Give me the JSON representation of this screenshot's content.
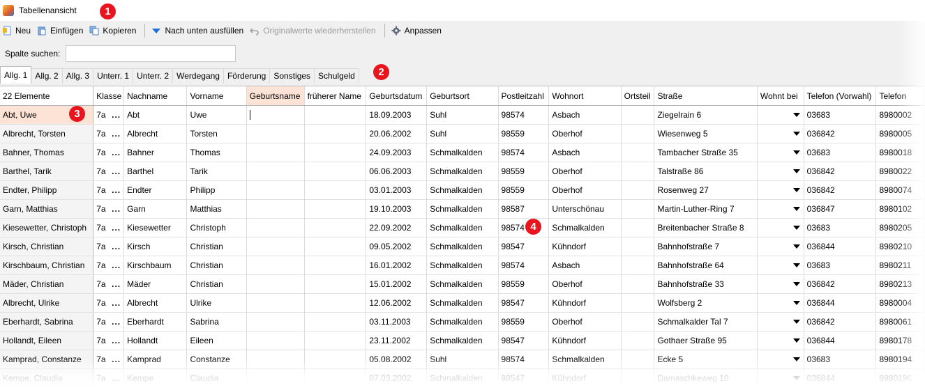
{
  "window": {
    "title": "Tabellenansicht"
  },
  "toolbar": {
    "new_label": "Neu",
    "insert_label": "Einfügen",
    "copy_label": "Kopieren",
    "fill_down_label": "Nach unten ausfüllen",
    "restore_label": "Originalwerte wiederherstellen",
    "customize_label": "Anpassen"
  },
  "search": {
    "label": "Spalte suchen:",
    "value": "",
    "placeholder": ""
  },
  "tabs": [
    {
      "label": "Allg. 1"
    },
    {
      "label": "Allg. 2"
    },
    {
      "label": "Allg. 3"
    },
    {
      "label": "Unterr. 1"
    },
    {
      "label": "Unterr. 2"
    },
    {
      "label": "Werdegang"
    },
    {
      "label": "Förderung"
    },
    {
      "label": "Sonstiges"
    },
    {
      "label": "Schulgeld"
    }
  ],
  "grid": {
    "count_label": "22 Elemente",
    "columns": [
      "Klasse",
      "Nachname",
      "Vorname",
      "Geburtsname",
      "früherer Name",
      "Geburtsdatum",
      "Geburtsort",
      "Postleitzahl",
      "Wohnort",
      "Ortsteil",
      "Straße",
      "Wohnt bei",
      "Telefon (Vorwahl)",
      "Telefon"
    ],
    "rows": [
      {
        "head": "Abt, Uwe",
        "klasse": "7a",
        "nachname": "Abt",
        "vorname": "Uwe",
        "geburtsname": "",
        "frueher": "",
        "geburtsdatum": "18.09.2003",
        "geburtsort": "Suhl",
        "plz": "98574",
        "wohnort": "Asbach",
        "ortsteil": "",
        "strasse": "Ziegelrain 6",
        "vorwahl": "03683",
        "telefon": "8980002"
      },
      {
        "head": "Albrecht, Torsten",
        "klasse": "7a",
        "nachname": "Albrecht",
        "vorname": "Torsten",
        "geburtsname": "",
        "frueher": "",
        "geburtsdatum": "20.06.2002",
        "geburtsort": "Suhl",
        "plz": "98559",
        "wohnort": "Oberhof",
        "ortsteil": "",
        "strasse": "Wiesenweg 5",
        "vorwahl": "036842",
        "telefon": "8980005"
      },
      {
        "head": "Bahner, Thomas",
        "klasse": "7a",
        "nachname": "Bahner",
        "vorname": "Thomas",
        "geburtsname": "",
        "frueher": "",
        "geburtsdatum": "24.09.2003",
        "geburtsort": "Schmalkalden",
        "plz": "98574",
        "wohnort": "Asbach",
        "ortsteil": "",
        "strasse": "Tambacher Straße 35",
        "vorwahl": "03683",
        "telefon": "8980018"
      },
      {
        "head": "Barthel, Tarik",
        "klasse": "7a",
        "nachname": "Barthel",
        "vorname": "Tarik",
        "geburtsname": "",
        "frueher": "",
        "geburtsdatum": "06.06.2003",
        "geburtsort": "Schmalkalden",
        "plz": "98559",
        "wohnort": "Oberhof",
        "ortsteil": "",
        "strasse": "Talstraße 86",
        "vorwahl": "036842",
        "telefon": "8980022"
      },
      {
        "head": "Endter, Philipp",
        "klasse": "7a",
        "nachname": "Endter",
        "vorname": "Philipp",
        "geburtsname": "",
        "frueher": "",
        "geburtsdatum": "03.01.2003",
        "geburtsort": "Schmalkalden",
        "plz": "98559",
        "wohnort": "Oberhof",
        "ortsteil": "",
        "strasse": "Rosenweg 27",
        "vorwahl": "036842",
        "telefon": "8980074"
      },
      {
        "head": "Garn, Matthias",
        "klasse": "7a",
        "nachname": "Garn",
        "vorname": "Matthias",
        "geburtsname": "",
        "frueher": "",
        "geburtsdatum": "19.10.2003",
        "geburtsort": "Schmalkalden",
        "plz": "98587",
        "wohnort": "Unterschönau",
        "ortsteil": "",
        "strasse": "Martin-Luther-Ring 7",
        "vorwahl": "036847",
        "telefon": "8980102"
      },
      {
        "head": "Kiesewetter, Christoph",
        "klasse": "7a",
        "nachname": "Kiesewetter",
        "vorname": "Christoph",
        "geburtsname": "",
        "frueher": "",
        "geburtsdatum": "22.09.2002",
        "geburtsort": "Schmalkalden",
        "plz": "98574",
        "wohnort": "Schmalkalden",
        "ortsteil": "",
        "strasse": "Breitenbacher Straße 8",
        "vorwahl": "03683",
        "telefon": "8980205"
      },
      {
        "head": "Kirsch, Christian",
        "klasse": "7a",
        "nachname": "Kirsch",
        "vorname": "Christian",
        "geburtsname": "",
        "frueher": "",
        "geburtsdatum": "09.05.2002",
        "geburtsort": "Schmalkalden",
        "plz": "98547",
        "wohnort": "Kühndorf",
        "ortsteil": "",
        "strasse": "Bahnhofstraße 7",
        "vorwahl": "036844",
        "telefon": "8980210"
      },
      {
        "head": "Kirschbaum, Christian",
        "klasse": "7a",
        "nachname": "Kirschbaum",
        "vorname": "Christian",
        "geburtsname": "",
        "frueher": "",
        "geburtsdatum": "16.01.2002",
        "geburtsort": "Schmalkalden",
        "plz": "98574",
        "wohnort": "Asbach",
        "ortsteil": "",
        "strasse": "Bahnhofstraße 64",
        "vorwahl": "03683",
        "telefon": "8980211"
      },
      {
        "head": "Mäder, Christian",
        "klasse": "7a",
        "nachname": "Mäder",
        "vorname": "Christian",
        "geburtsname": "",
        "frueher": "",
        "geburtsdatum": "15.01.2002",
        "geburtsort": "Schmalkalden",
        "plz": "98559",
        "wohnort": "Oberhof",
        "ortsteil": "",
        "strasse": "Bahnhofstraße 33",
        "vorwahl": "036842",
        "telefon": "8980213"
      },
      {
        "head": "Albrecht, Ulrike",
        "klasse": "7a",
        "nachname": "Albrecht",
        "vorname": "Ulrike",
        "geburtsname": "",
        "frueher": "",
        "geburtsdatum": "12.06.2002",
        "geburtsort": "Schmalkalden",
        "plz": "98547",
        "wohnort": "Kühndorf",
        "ortsteil": "",
        "strasse": "Wolfsberg 2",
        "vorwahl": "036844",
        "telefon": "8980004"
      },
      {
        "head": "Eberhardt, Sabrina",
        "klasse": "7a",
        "nachname": "Eberhardt",
        "vorname": "Sabrina",
        "geburtsname": "",
        "frueher": "",
        "geburtsdatum": "03.11.2003",
        "geburtsort": "Schmalkalden",
        "plz": "98559",
        "wohnort": "Oberhof",
        "ortsteil": "",
        "strasse": "Schmalkalder Tal 7",
        "vorwahl": "036842",
        "telefon": "8980061"
      },
      {
        "head": "Hollandt, Eileen",
        "klasse": "7a",
        "nachname": "Hollandt",
        "vorname": "Eileen",
        "geburtsname": "",
        "frueher": "",
        "geburtsdatum": "23.11.2002",
        "geburtsort": "Schmalkalden",
        "plz": "98547",
        "wohnort": "Kühndorf",
        "ortsteil": "",
        "strasse": "Gothaer Straße 95",
        "vorwahl": "036844",
        "telefon": "8980178"
      },
      {
        "head": "Kamprad, Constanze",
        "klasse": "7a",
        "nachname": "Kamprad",
        "vorname": "Constanze",
        "geburtsname": "",
        "frueher": "",
        "geburtsdatum": "05.08.2002",
        "geburtsort": "Suhl",
        "plz": "98574",
        "wohnort": "Schmalkalden",
        "ortsteil": "",
        "strasse": "Ecke 5",
        "vorwahl": "03683",
        "telefon": "8980194"
      },
      {
        "head": "Kempe, Claudia",
        "klasse": "7a",
        "nachname": "Kempe",
        "vorname": "Claudia",
        "geburtsname": "",
        "frueher": "",
        "geburtsdatum": "07.03.2002",
        "geburtsort": "Schmalkalden",
        "plz": "98547",
        "wohnort": "Kühndorf",
        "ortsteil": "",
        "strasse": "Damaschkeweg 10",
        "vorwahl": "036844",
        "telefon": "8980196"
      }
    ]
  },
  "callouts": [
    "1",
    "2",
    "3",
    "4"
  ],
  "colors": {
    "accent_highlight": "#fde3d5",
    "callout_red": "#e8141e",
    "toolbar_blue": "#1f6fd0"
  }
}
